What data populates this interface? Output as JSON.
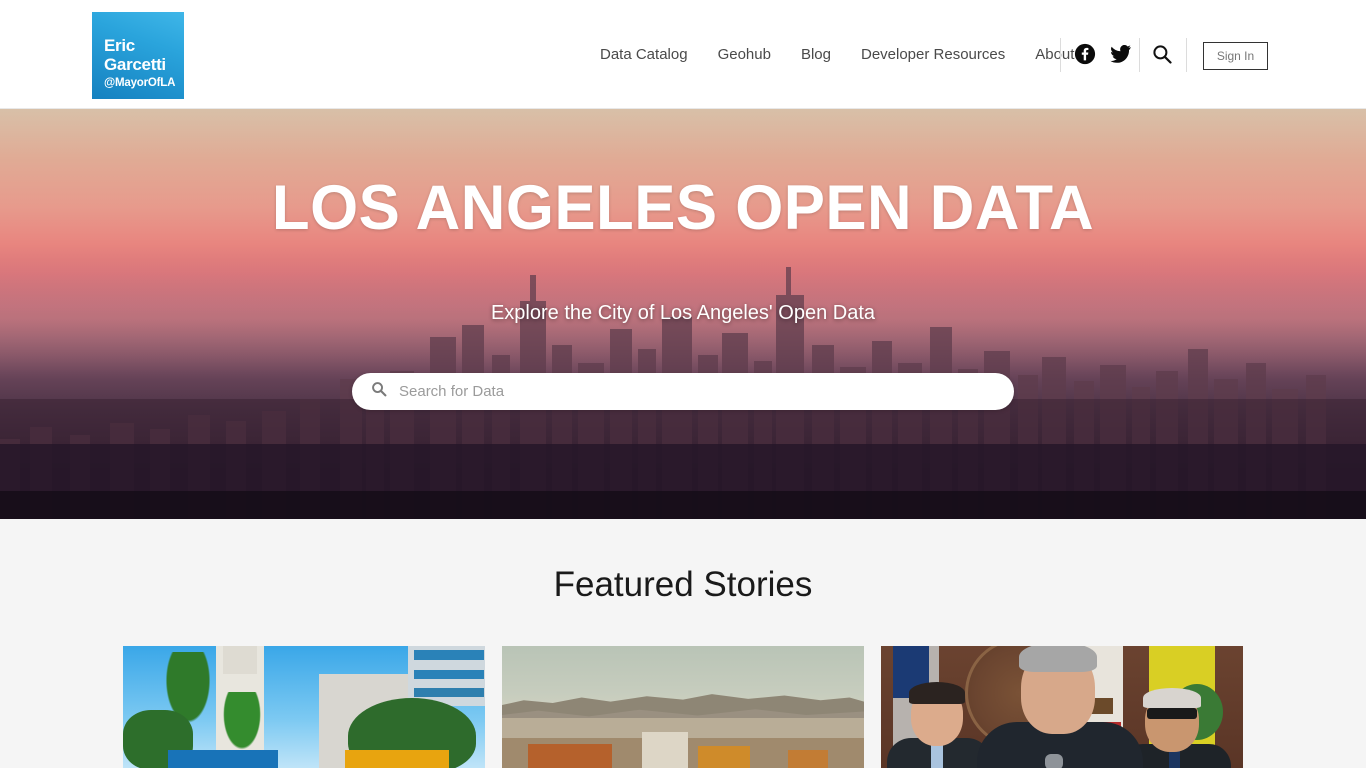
{
  "header": {
    "logo": {
      "line1": "Eric",
      "line2": "Garcetti",
      "handle": "@MayorOfLA"
    },
    "nav": [
      {
        "label": "Data Catalog",
        "name": "nav-data-catalog"
      },
      {
        "label": "Geohub",
        "name": "nav-geohub"
      },
      {
        "label": "Blog",
        "name": "nav-blog"
      },
      {
        "label": "Developer Resources",
        "name": "nav-developer-resources"
      },
      {
        "label": "About",
        "name": "nav-about"
      }
    ],
    "icons": {
      "facebook": "facebook-icon",
      "twitter": "twitter-icon",
      "search": "search-icon"
    },
    "sign_in_label": "Sign In"
  },
  "hero": {
    "title": "LOS ANGELES OPEN DATA",
    "subtitle": "Explore the City of Los Angeles' Open Data",
    "search": {
      "placeholder": "Search for Data",
      "value": "",
      "icon": "search-icon"
    }
  },
  "featured": {
    "title": "Featured Stories",
    "cards": [
      {
        "name": "story-card-city-hall",
        "alt": "Los Angeles City Hall with palm trees"
      },
      {
        "name": "story-card-hollywood-hills",
        "alt": "Los Angeles cityscape with hills"
      },
      {
        "name": "story-card-press-conference",
        "alt": "Mayor and LAPD chief at press conference"
      }
    ]
  },
  "colors": {
    "brand_blue": "#1581c0",
    "page_background": "#f5f5f5",
    "header_background": "#ffffff",
    "nav_text": "#4a4a4a",
    "hero_text": "#ffffff"
  }
}
